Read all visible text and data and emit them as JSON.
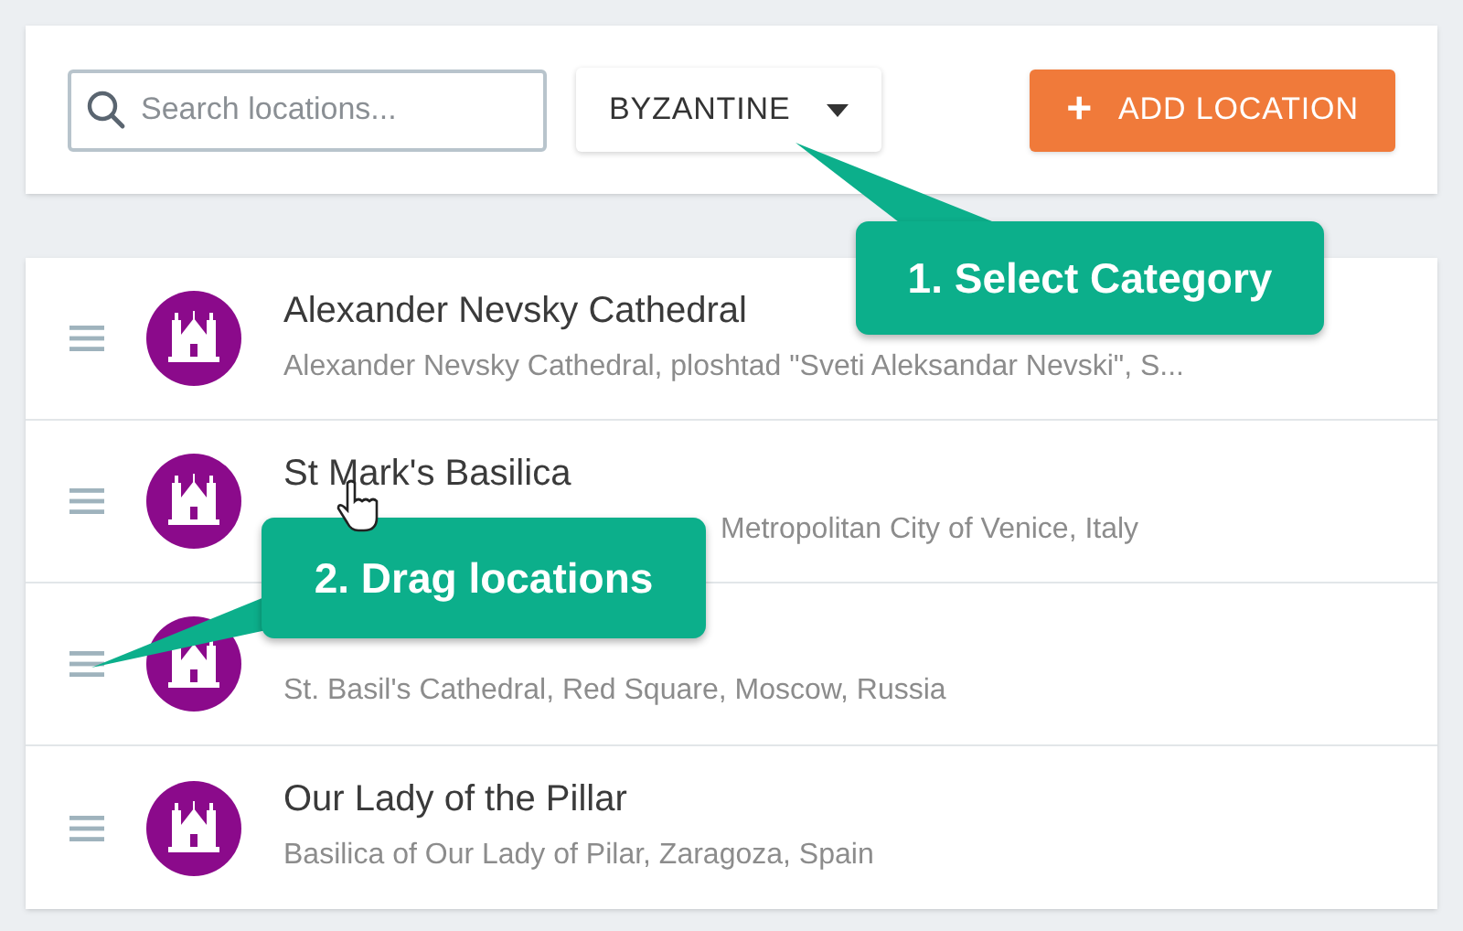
{
  "toolbar": {
    "search": {
      "placeholder": "Search locations..."
    },
    "category": {
      "value": "BYZANTINE"
    },
    "add_button": {
      "label": "ADD LOCATION",
      "icon": "+"
    }
  },
  "locations": [
    {
      "title": "Alexander Nevsky Cathedral",
      "subtitle": "Alexander Nevsky Cathedral, ploshtad \"Sveti Aleksandar Nevski\", S..."
    },
    {
      "title": "St Mark's Basilica",
      "subtitle": "Metropolitan City of Venice, Italy"
    },
    {
      "subtitle": "St. Basil's Cathedral, Red Square, Moscow, Russia"
    },
    {
      "title": "Our Lady of the Pillar",
      "subtitle": "Basilica of Our Lady of Pilar, Zaragoza, Spain"
    }
  ],
  "callouts": [
    {
      "text": "1. Select Category"
    },
    {
      "text": "2. Drag locations"
    }
  ]
}
